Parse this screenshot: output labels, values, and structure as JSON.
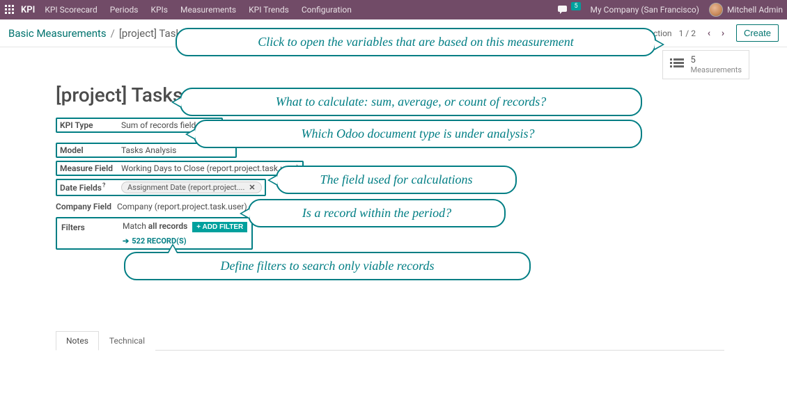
{
  "topnav": {
    "brand": "KPI",
    "items": [
      "KPI Scorecard",
      "Periods",
      "KPIs",
      "Measurements",
      "KPI Trends",
      "Configuration"
    ],
    "chat_count": "5",
    "company": "My Company (San Francisco)",
    "user": "Mitchell Admin"
  },
  "breadcrumb": {
    "root": "Basic Measurements",
    "current": "[project] Tasks: W"
  },
  "controls": {
    "action": "Action",
    "pager": "1 / 2",
    "create": "Create"
  },
  "statbox": {
    "count": "5",
    "label": "Measurements"
  },
  "form": {
    "title": "[project] Tasks:",
    "fields": {
      "kpi_type": {
        "label": "KPI Type",
        "value": "Sum of records field"
      },
      "model": {
        "label": "Model",
        "value": "Tasks Analysis"
      },
      "measure_field": {
        "label": "Measure Field",
        "value": "Working Days to Close (report.project.task.user)"
      },
      "date_fields": {
        "label": "Date Fields",
        "sup": "?",
        "tag": "Assignment Date (report.project...."
      },
      "company_field": {
        "label": "Company Field",
        "value": "Company (report.project.task.user)"
      },
      "filters": {
        "label": "Filters",
        "match_prefix": "Match ",
        "match_strong": "all records",
        "add_filter": "+ ADD FILTER",
        "records": "522 RECORD(S)"
      }
    }
  },
  "callouts": {
    "c1": "Click to open the variables that are based on this measurement",
    "c2": "What to calculate: sum, average, or count of records?",
    "c3": "Which Odoo document type is under analysis?",
    "c4": "The field used for calculations",
    "c5": "Is a record within the period?",
    "c6": "Define filters to search only viable records"
  },
  "tabs": {
    "notes": "Notes",
    "technical": "Technical"
  }
}
